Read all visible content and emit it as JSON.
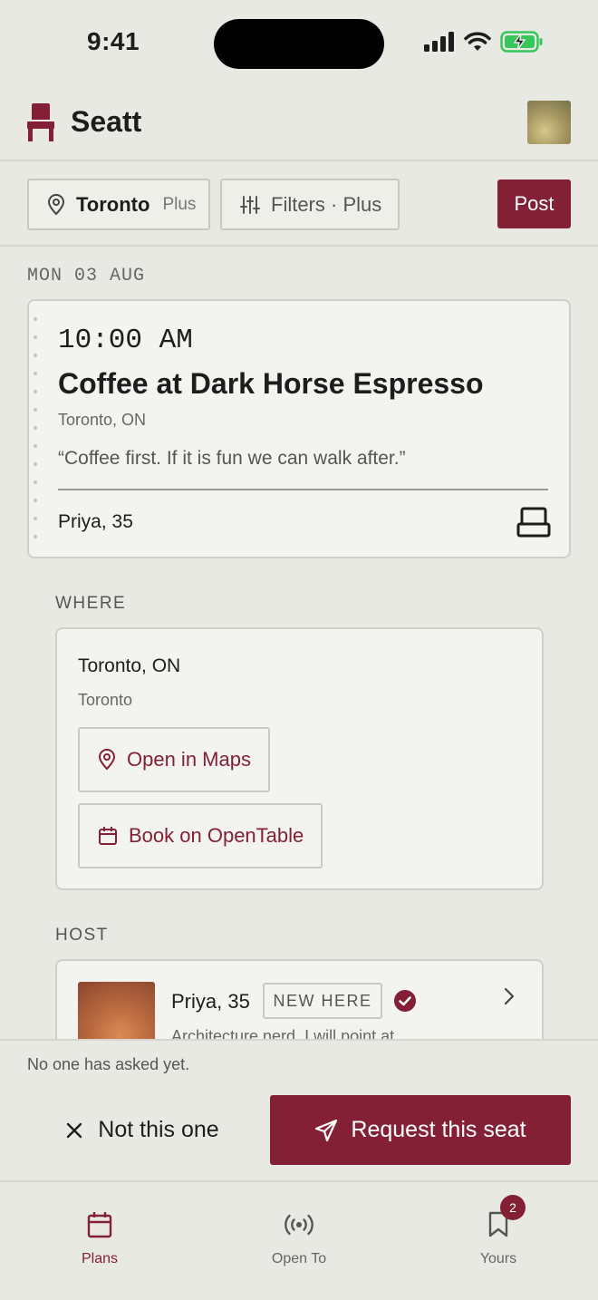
{
  "status_bar": {
    "time": "9:41"
  },
  "header": {
    "app_name": "Seatt",
    "brand_icon": "chair-icon",
    "avatar_icon": "profile-avatar"
  },
  "filters": {
    "location": "Toronto",
    "location_tag": "Plus",
    "filters_label": "Filters · Plus",
    "post_label": "Post"
  },
  "date_header": "MON 03 AUG",
  "plan": {
    "time": "10:00 AM",
    "title": "Coffee at Dark Horse Espresso",
    "location": "Toronto, ON",
    "quote": "“Coffee first. If it is fun we can walk after.”",
    "host": "Priya, 35",
    "seat_icon": "seat-icon"
  },
  "where": {
    "label": "WHERE",
    "title": "Toronto, ON",
    "subtitle": "Toronto",
    "maps_label": "Open in Maps",
    "opentable_label": "Book on OpenTable"
  },
  "host": {
    "label": "HOST",
    "name": "Priya, 35",
    "badge": "NEW HERE",
    "bio": "Architecture nerd. I will point at"
  },
  "actions": {
    "status": "No one has asked yet.",
    "decline_label": "Not this one",
    "request_label": "Request this seat"
  },
  "tabs": [
    {
      "label": "Plans",
      "icon": "calendar-icon"
    },
    {
      "label": "Open To",
      "icon": "broadcast-icon"
    },
    {
      "label": "Yours",
      "icon": "bookmark-icon",
      "badge": "2"
    }
  ],
  "colors": {
    "accent": "#842036",
    "background": "#e9e9e4",
    "card": "#f3f3ef"
  }
}
